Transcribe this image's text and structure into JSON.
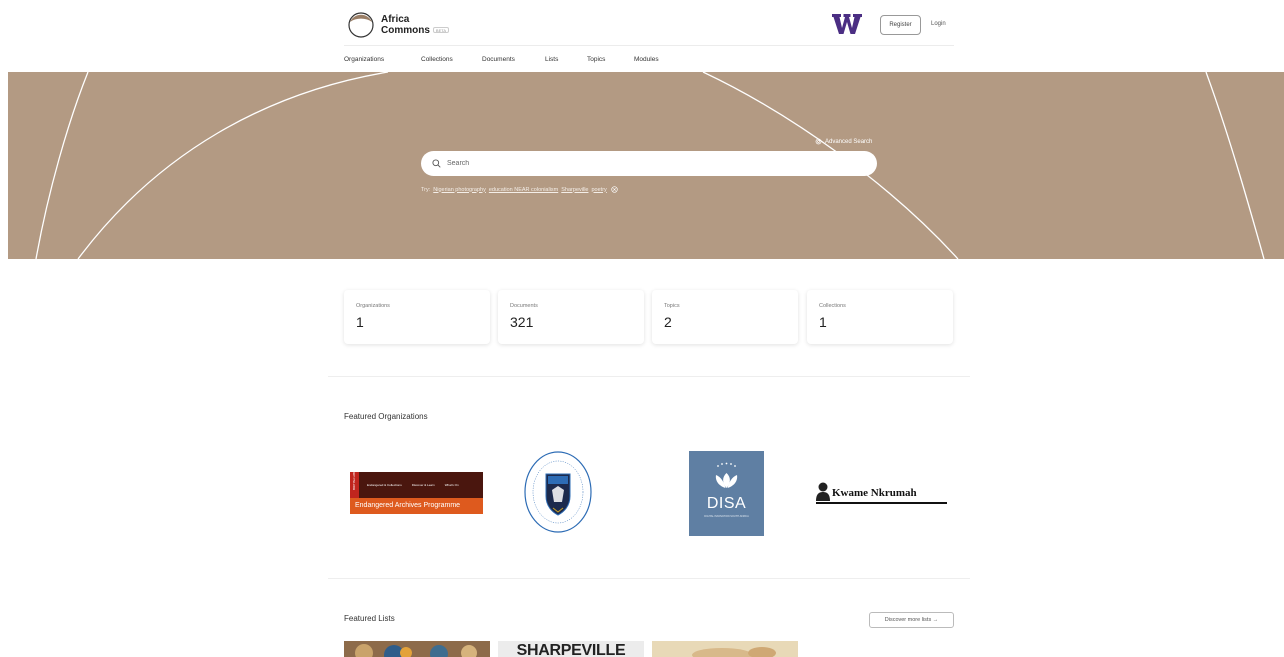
{
  "brand": {
    "line1": "Africa",
    "line2": "Commons",
    "badge": "BETA"
  },
  "header": {
    "register_label": "Register",
    "login_label": "Login"
  },
  "nav": [
    "Organizations",
    "Collections",
    "Documents",
    "Lists",
    "Topics",
    "Modules"
  ],
  "hero": {
    "advanced_search_label": "Advanced Search",
    "search_placeholder": "Search",
    "try_label": "Try:",
    "suggestions": [
      "Nigerian photography",
      "education NEAR colonialism",
      "Sharpeville",
      "poetry"
    ]
  },
  "stats": [
    {
      "label": "Organizations",
      "value": "1"
    },
    {
      "label": "Documents",
      "value": "321"
    },
    {
      "label": "Topics",
      "value": "2"
    },
    {
      "label": "Collections",
      "value": "1"
    }
  ],
  "featured_orgs": {
    "title": "Featured Organizations",
    "eap": {
      "side_text": "BRITISH LIBRARY",
      "nav": [
        "Endangered & Collections",
        "Discover & Learn",
        "What's On"
      ],
      "name": "Endangered Archives Programme"
    },
    "disa": {
      "name": "DISA",
      "tagline": "DIGITAL INNOVATION SOUTH AFRICA"
    },
    "kwame": {
      "name": "Kwame Nkrumah"
    }
  },
  "featured_lists": {
    "title": "Featured Lists",
    "discover_label": "Discover more lists",
    "thumb_text": "SHARPEVILLE"
  },
  "colors": {
    "hero_bg": "#b39a83",
    "uw_purple": "#4b2e83",
    "eap_dark": "#4a160e",
    "eap_orange": "#de5a1e",
    "disa_blue": "#5f7fa3"
  }
}
